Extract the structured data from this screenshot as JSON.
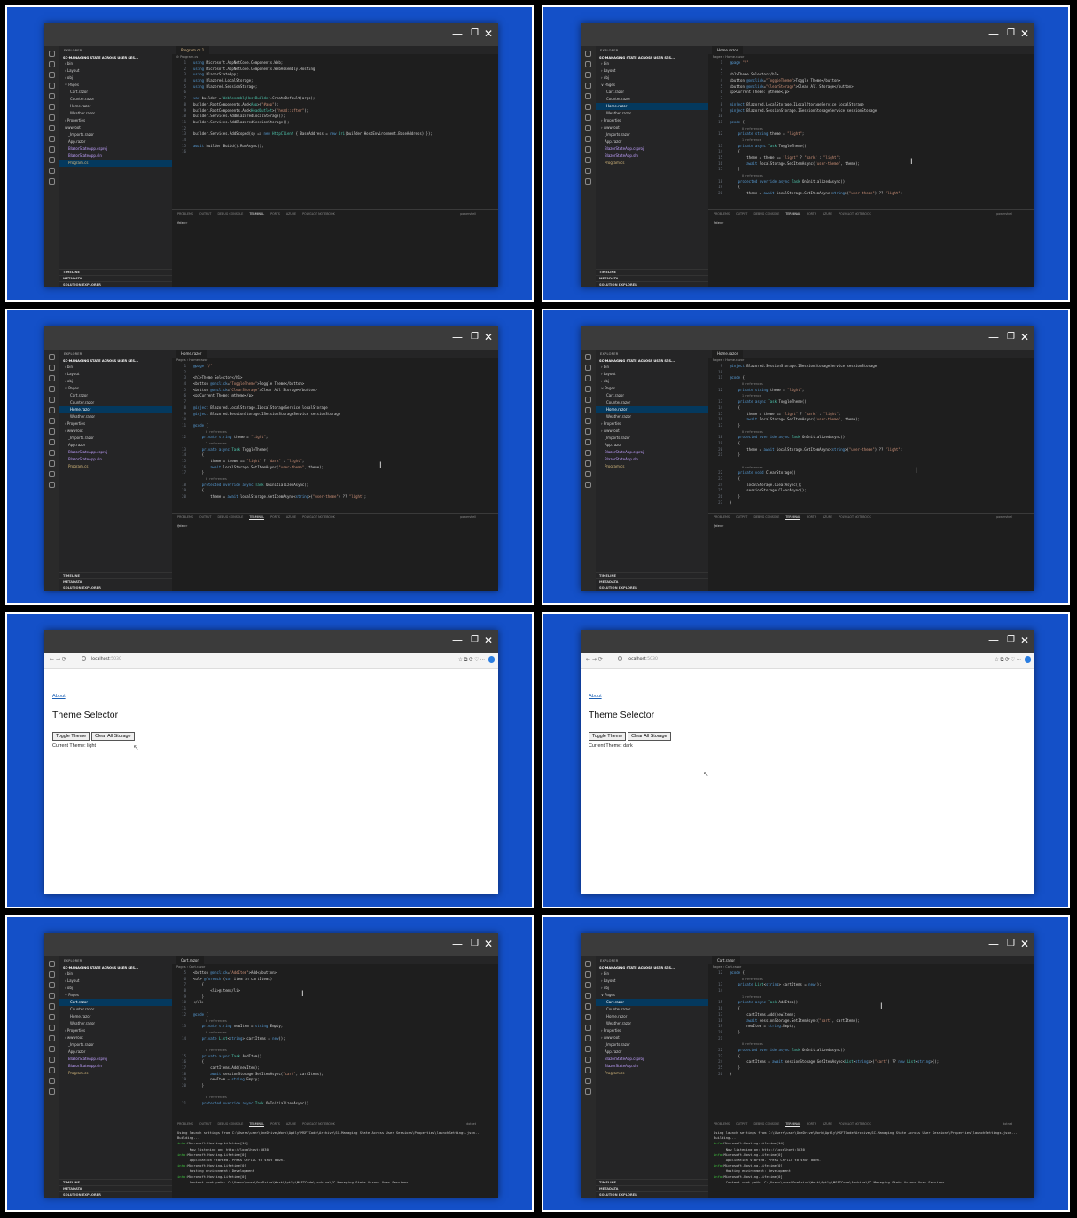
{
  "window_controls": {
    "minimize": "—",
    "maximize": "❐",
    "close": "✕"
  },
  "explorer": {
    "header": "EXPLORER",
    "project": "SC-MANAGING STATE ACROSS USER SES...",
    "footer": [
      "TIMELINE",
      "METADATA",
      "SOLUTION EXPLORER"
    ]
  },
  "terminal_prompt": "@dev>",
  "panel_tabs": [
    "PROBLEMS",
    "OUTPUT",
    "DEBUG CONSOLE",
    "TERMINAL",
    "PORTS",
    "AZURE",
    "POLYGLOT NOTEBOOK"
  ],
  "shells": [
    "powershell",
    "powershell",
    "powershell",
    "powershell",
    "dotnet",
    "dotnet"
  ],
  "files_pages": [
    {
      "label": "› bin",
      "indent": 6
    },
    {
      "label": "› Layout",
      "indent": 6
    },
    {
      "label": "› obj",
      "indent": 6
    },
    {
      "label": "∨ Pages",
      "indent": 6
    },
    {
      "label": "Cart.razor",
      "indent": 12
    },
    {
      "label": "Counter.razor",
      "indent": 12
    },
    {
      "label": "Home.razor",
      "indent": 12
    },
    {
      "label": "Weather.razor",
      "indent": 12
    },
    {
      "label": "› Properties",
      "indent": 6
    },
    {
      "label": "› wwwroot",
      "indent": 6
    },
    {
      "label": "_Imports.razor",
      "indent": 10
    },
    {
      "label": "App.razor",
      "indent": 10
    },
    {
      "label": "BlazorStateApp.csproj",
      "indent": 10
    },
    {
      "label": "BlazorStateApp.sln",
      "indent": 10
    },
    {
      "label": "Program.cs",
      "indent": 10
    }
  ],
  "files_program": [
    {
      "label": "› bin",
      "indent": 6
    },
    {
      "label": "› Layout",
      "indent": 6
    },
    {
      "label": "› obj",
      "indent": 6
    },
    {
      "label": "∨ Pages",
      "indent": 6
    },
    {
      "label": "Cart.razor",
      "indent": 12
    },
    {
      "label": "Counter.razor",
      "indent": 12
    },
    {
      "label": "Home.razor",
      "indent": 12
    },
    {
      "label": "Weather.razor",
      "indent": 12
    },
    {
      "label": "› Properties",
      "indent": 6
    },
    {
      "label": "wwwroot",
      "indent": 6
    },
    {
      "label": "_Imports.razor",
      "indent": 10
    },
    {
      "label": "App.razor",
      "indent": 10
    },
    {
      "label": "BlazorStateApp.csproj",
      "indent": 10
    },
    {
      "label": "BlazorStateApp.sln",
      "indent": 10
    },
    {
      "label": "Program.cs",
      "indent": 10
    }
  ],
  "tiles": [
    {
      "kind": "editor",
      "tab": "Program.cs 1",
      "breadcrumb": "⊘ Program.cs",
      "files_key": "files_program",
      "selected": 14,
      "code": [
        [
          "1",
          "using Microsoft.AspNetCore.Components.Web;"
        ],
        [
          "2",
          "using Microsoft.AspNetCore.Components.WebAssembly.Hosting;"
        ],
        [
          "3",
          "using BlazorStateApp;"
        ],
        [
          "4",
          "using Blazored.LocalStorage;"
        ],
        [
          "5",
          "using Blazored.SessionStorage;"
        ],
        [
          "6",
          ""
        ],
        [
          "7",
          "var builder = WebAssemblyHostBuilder.CreateDefault(args);"
        ],
        [
          "8",
          "builder.RootComponents.Add<App>(\"#app\");"
        ],
        [
          "9",
          "builder.RootComponents.Add<HeadOutlet>(\"head::after\");"
        ],
        [
          "10",
          "builder.Services.AddBlazoredLocalStorage();"
        ],
        [
          "11",
          "builder.Services.AddBlazoredSessionStorage();"
        ],
        [
          "12",
          ""
        ],
        [
          "13",
          "builder.Services.AddScoped(sp => new HttpClient { BaseAddress = new Uri(builder.HostEnvironment.BaseAddress) });"
        ],
        [
          "14",
          ""
        ],
        [
          "15",
          "await builder.Build().RunAsync();"
        ],
        [
          "16",
          ""
        ]
      ],
      "terminal": []
    },
    {
      "kind": "editor",
      "tab": "Home.razor",
      "breadcrumb": "Pages › Home.razor",
      "files_key": "files_pages",
      "selected": 6,
      "code": [
        [
          "1",
          "@page \"/\""
        ],
        [
          "2",
          ""
        ],
        [
          "3",
          "<h1>Theme Selector</h1>"
        ],
        [
          "4",
          "<button @onclick=\"ToggleTheme\">Toggle Theme</button>"
        ],
        [
          "5",
          "<button @onclick=\"ClearStorage\">Clear All Storage</button>"
        ],
        [
          "6",
          "<p>Current Theme: @theme</p>"
        ],
        [
          "7",
          ""
        ],
        [
          "8",
          "@inject Blazored.LocalStorage.ILocalStorageService localStorage"
        ],
        [
          "9",
          "@inject Blazored.SessionStorage.ISessionStorageService sessionStorage"
        ],
        [
          "10",
          ""
        ],
        [
          "11",
          "@code {"
        ],
        [
          "",
          "0 references"
        ],
        [
          "12",
          "    private string theme = \"light\";"
        ],
        [
          "",
          "1 reference"
        ],
        [
          "13",
          "    private async Task ToggleTheme()"
        ],
        [
          "14",
          "    {"
        ],
        [
          "15",
          "        theme = theme == \"light\" ? \"dark\" : \"light\";"
        ],
        [
          "16",
          "        await localStorage.SetItemAsync(\"user-theme\", theme);"
        ],
        [
          "17",
          "    }"
        ],
        [
          "",
          "0 references"
        ],
        [
          "18",
          "    protected override async Task OnInitializedAsync()"
        ],
        [
          "19",
          "    {"
        ],
        [
          "20",
          "        theme = await localStorage.GetItemAsync<string>(\"user-theme\") ?? \"light\";"
        ]
      ],
      "terminal": []
    },
    {
      "kind": "editor",
      "tab": "Home.razor",
      "breadcrumb": "Pages › Home.razor",
      "files_key": "files_pages",
      "selected": 6,
      "code": [
        [
          "1",
          "@page \"/\""
        ],
        [
          "2",
          ""
        ],
        [
          "3",
          "<h1>Theme Selector</h1>"
        ],
        [
          "4",
          "<button @onclick=\"ToggleTheme\">Toggle Theme</button>"
        ],
        [
          "5",
          "<button @onclick=\"ClearStorage\">Clear All Storage</button>"
        ],
        [
          "6",
          "<p>Current Theme: @theme</p>"
        ],
        [
          "7",
          ""
        ],
        [
          "8",
          "@inject Blazored.LocalStorage.ILocalStorageService localStorage"
        ],
        [
          "9",
          "@inject Blazored.SessionStorage.ISessionStorageService sessionStorage"
        ],
        [
          "10",
          ""
        ],
        [
          "11",
          "@code {"
        ],
        [
          "",
          "0 references"
        ],
        [
          "12",
          "    private string theme = \"light\";"
        ],
        [
          "",
          "2 references"
        ],
        [
          "13",
          "    private async Task ToggleTheme()"
        ],
        [
          "14",
          "    {"
        ],
        [
          "15",
          "        theme = theme == \"light\" ? \"dark\" : \"light\";"
        ],
        [
          "16",
          "        await localStorage.SetItemAsync(\"user-theme\", theme);"
        ],
        [
          "17",
          "    }"
        ],
        [
          "",
          "0 references"
        ],
        [
          "18",
          "    protected override async Task OnInitializedAsync()"
        ],
        [
          "19",
          "    {"
        ],
        [
          "20",
          "        theme = await localStorage.GetItemAsync<string>(\"user-theme\") ?? \"light\";"
        ]
      ],
      "terminal": []
    },
    {
      "kind": "editor",
      "tab": "Home.razor",
      "breadcrumb": "Pages › Home.razor",
      "files_key": "files_pages",
      "selected": 6,
      "code": [
        [
          "9",
          "@inject Blazored.SessionStorage.ISessionStorageService sessionStorage"
        ],
        [
          "10",
          ""
        ],
        [
          "11",
          "@code {"
        ],
        [
          "",
          "0 references"
        ],
        [
          "12",
          "    private string theme = \"light\";"
        ],
        [
          "",
          "1 reference"
        ],
        [
          "13",
          "    private async Task ToggleTheme()"
        ],
        [
          "14",
          "    {"
        ],
        [
          "15",
          "        theme = theme == \"light\" ? \"dark\" : \"light\";"
        ],
        [
          "16",
          "        await localStorage.SetItemAsync(\"user-theme\", theme);"
        ],
        [
          "17",
          "    }"
        ],
        [
          "",
          "0 references"
        ],
        [
          "18",
          "    protected override async Task OnInitializedAsync()"
        ],
        [
          "19",
          "    {"
        ],
        [
          "20",
          "        theme = await localStorage.GetItemAsync<string>(\"user-theme\") ?? \"light\";"
        ],
        [
          "21",
          "    }"
        ],
        [
          "",
          ""
        ],
        [
          "",
          "0 references"
        ],
        [
          "22",
          "    private void ClearStorage()"
        ],
        [
          "23",
          "    {"
        ],
        [
          "24",
          "        localStorage.ClearAsync();"
        ],
        [
          "25",
          "        sessionStorage.ClearAsync();"
        ],
        [
          "26",
          "    }"
        ],
        [
          "27",
          "}"
        ]
      ],
      "terminal": []
    },
    {
      "kind": "browser",
      "url": "localhost",
      "port": ":5030",
      "link": "About",
      "heading": "Theme Selector",
      "buttons": [
        "Toggle Theme",
        "Clear All Storage"
      ],
      "current_theme": "Current Theme: light"
    },
    {
      "kind": "browser",
      "url": "localhost",
      "port": ":5030",
      "link": "About",
      "heading": "Theme Selector",
      "buttons": [
        "Toggle Theme",
        "Clear All Storage"
      ],
      "current_theme": "Current Theme: dark"
    },
    {
      "kind": "editor",
      "tab": "Cart.razor",
      "breadcrumb": "Pages › Cart.razor",
      "files_key": "files_pages",
      "selected": 4,
      "code": [
        [
          "5",
          "<button @onclick=\"AddItem\">Add</button>"
        ],
        [
          "6",
          "<ul> @foreach (var item in cartItems)"
        ],
        [
          "7",
          "    {"
        ],
        [
          "8",
          "        <li>@item</li>"
        ],
        [
          "9",
          "    }"
        ],
        [
          "10",
          "</ul>"
        ],
        [
          "11",
          ""
        ],
        [
          "12",
          "@code {"
        ],
        [
          "",
          "0 references"
        ],
        [
          "13",
          "    private string newItem = string.Empty;"
        ],
        [
          "",
          "0 references"
        ],
        [
          "14",
          "    private List<string> cartItems = new();"
        ],
        [
          "",
          ""
        ],
        [
          "",
          "0 references"
        ],
        [
          "15",
          "    private async Task AddItem()"
        ],
        [
          "16",
          "    {"
        ],
        [
          "17",
          "        cartItems.Add(newItem);"
        ],
        [
          "18",
          "        await sessionStorage.SetItemAsync(\"cart\", cartItems);"
        ],
        [
          "19",
          "        newItem = string.Empty;"
        ],
        [
          "20",
          "    }"
        ],
        [
          "",
          ""
        ],
        [
          "",
          "0 references"
        ],
        [
          "21",
          "    protected override async Task OnInitializedAsync()"
        ]
      ],
      "terminal": [
        [
          "",
          "Using launch settings from C:\\Users\\user\\OneDrive\\Work\\Aptly\\MSFTCode\\Archive\\SC-Managing State Across User Sessions\\Properties\\launchSettings.json..."
        ],
        [
          "",
          "Building..."
        ],
        [
          "info:",
          "Microsoft.Hosting.Lifetime[14]"
        ],
        [
          "",
          "      Now listening on: http://localhost:5030"
        ],
        [
          "info:",
          "Microsoft.Hosting.Lifetime[0]"
        ],
        [
          "",
          "      Application started. Press Ctrl+C to shut down."
        ],
        [
          "info:",
          "Microsoft.Hosting.Lifetime[0]"
        ],
        [
          "",
          "      Hosting environment: Development"
        ],
        [
          "info:",
          "Microsoft.Hosting.Lifetime[0]"
        ],
        [
          "",
          "      Content root path: C:\\Users\\user\\OneDrive\\Work\\Aptly\\MSFTCode\\Archive\\SC-Managing State Across User Sessions"
        ]
      ]
    },
    {
      "kind": "editor",
      "tab": "Cart.razor",
      "breadcrumb": "Pages › Cart.razor",
      "files_key": "files_pages",
      "selected": 4,
      "code": [
        [
          "12",
          "@code {"
        ],
        [
          "",
          "0 references"
        ],
        [
          "13",
          "    private List<string> cartItems = new();"
        ],
        [
          "14",
          ""
        ],
        [
          "",
          "1 reference"
        ],
        [
          "15",
          "    private async Task AddItem()"
        ],
        [
          "16",
          "    {"
        ],
        [
          "17",
          "        cartItems.Add(newItem);"
        ],
        [
          "18",
          "        await sessionStorage.SetItemAsync(\"cart\", cartItems);"
        ],
        [
          "19",
          "        newItem = string.Empty;"
        ],
        [
          "20",
          "    }"
        ],
        [
          "21",
          ""
        ],
        [
          "",
          "0 references"
        ],
        [
          "22",
          "    protected override async Task OnInitializedAsync()"
        ],
        [
          "23",
          "    {"
        ],
        [
          "24",
          "        cartItems = await sessionStorage.GetItemAsync<List<string>>(\"cart\") ?? new List<string>();"
        ],
        [
          "25",
          "    }"
        ],
        [
          "26",
          "}"
        ]
      ],
      "terminal": [
        [
          "",
          "Using launch settings from C:\\Users\\user\\OneDrive\\Work\\Aptly\\MSFTCode\\Archive\\SC-Managing State Across User Sessions\\Properties\\launchSettings.json..."
        ],
        [
          "",
          "Building..."
        ],
        [
          "info:",
          "Microsoft.Hosting.Lifetime[14]"
        ],
        [
          "",
          "      Now listening on: http://localhost:5030"
        ],
        [
          "info:",
          "Microsoft.Hosting.Lifetime[0]"
        ],
        [
          "",
          "      Application started. Press Ctrl+C to shut down."
        ],
        [
          "info:",
          "Microsoft.Hosting.Lifetime[0]"
        ],
        [
          "",
          "      Hosting environment: Development"
        ],
        [
          "info:",
          "Microsoft.Hosting.Lifetime[0]"
        ],
        [
          "",
          "      Content root path: C:\\Users\\user\\OneDrive\\Work\\Aptly\\MSFTCode\\Archive\\SC-Managing State Across User Sessions"
        ]
      ]
    }
  ]
}
